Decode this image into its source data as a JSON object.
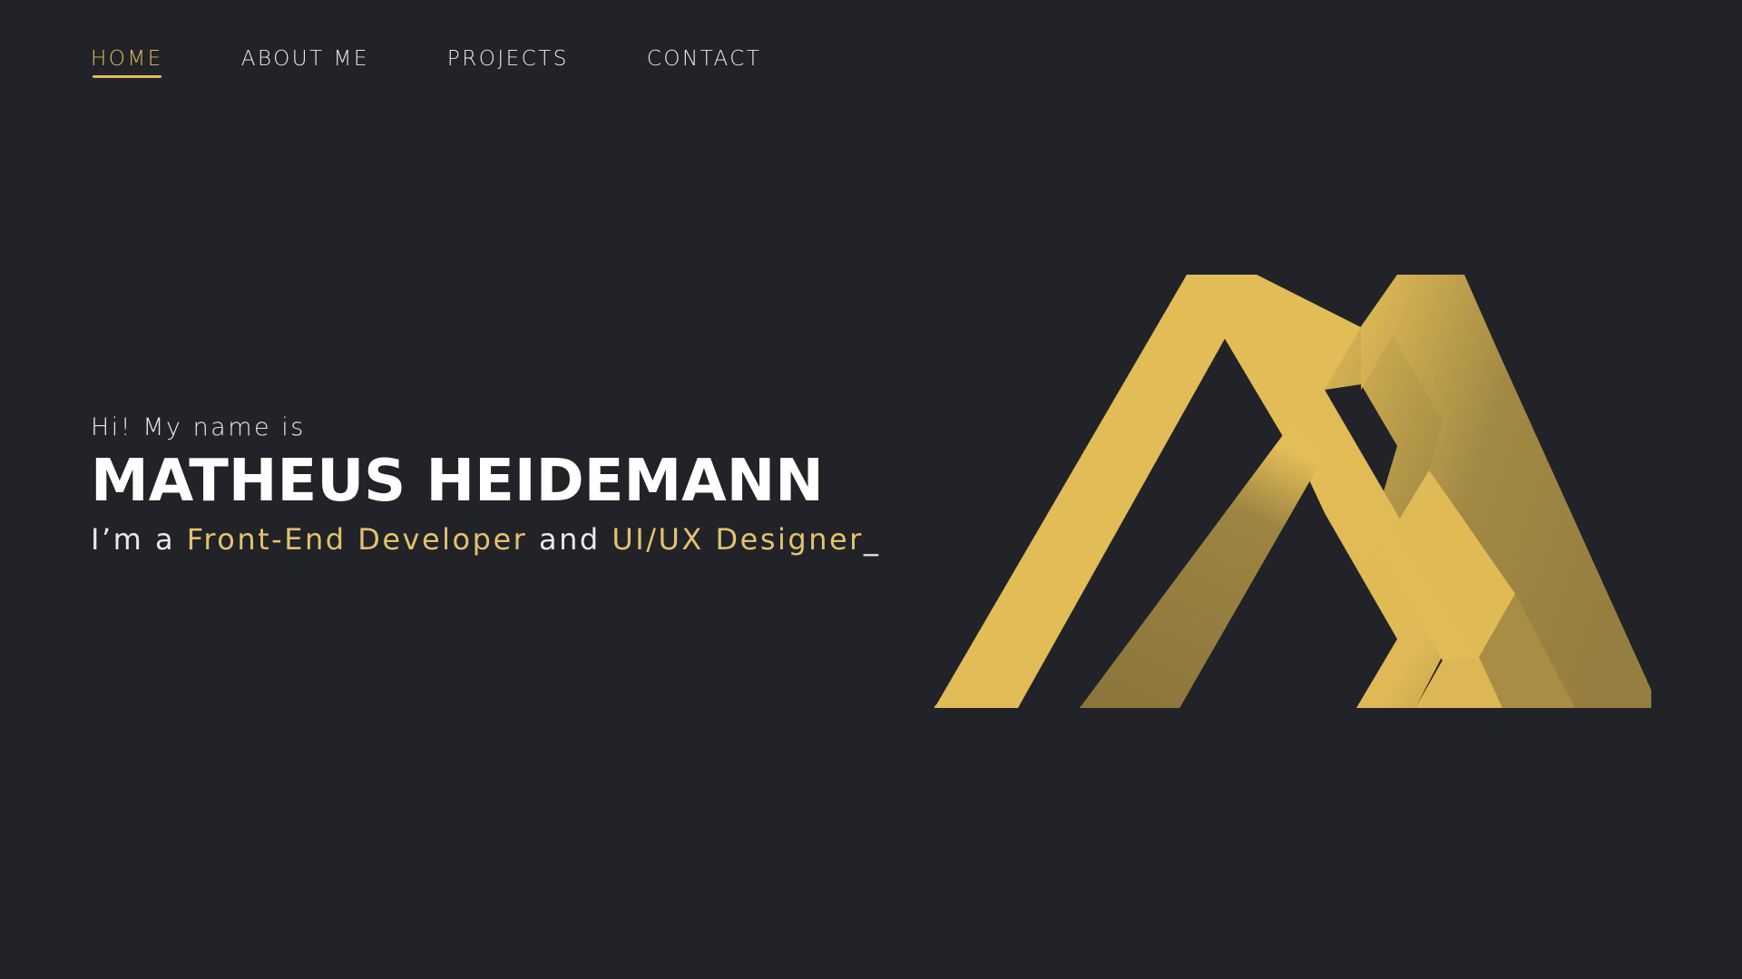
{
  "nav": {
    "items": [
      {
        "label": "HOME",
        "active": true
      },
      {
        "label": "ABOUT ME",
        "active": false
      },
      {
        "label": "PROJECTS",
        "active": false
      },
      {
        "label": "CONTACT",
        "active": false
      }
    ]
  },
  "hero": {
    "greeting": "Hi! My name is",
    "name": "MATHEUS HEIDEMANN",
    "tagline_prefix": "I’m a ",
    "role_1": "Front-End Developer",
    "tagline_joiner": " and ",
    "role_2": "UI/UX Designer",
    "cursor": "_"
  },
  "logo": {
    "icon": "mh-monogram-logo-icon"
  },
  "colors": {
    "background": "#212328",
    "accent": "#e2bc5a",
    "text": "#e9e9e9"
  }
}
